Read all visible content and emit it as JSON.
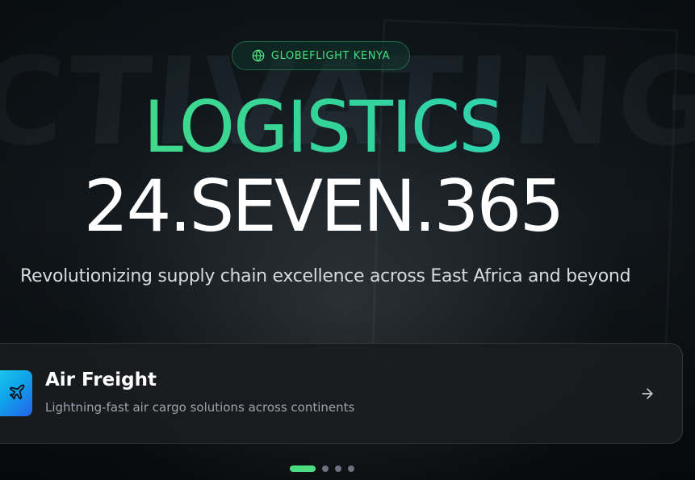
{
  "badge": {
    "icon": "globe-icon",
    "label": "GLOBEFLIGHT KENYA"
  },
  "hero": {
    "headline_line1": "LOGISTICS",
    "headline_line2": "24.SEVEN.365",
    "subtitle": "Revolutionizing supply chain excellence across East Africa and beyond"
  },
  "service": {
    "icon": "plane-icon",
    "title": "Air Freight",
    "description": "Lightning-fast air cargo solutions across continents",
    "next_icon": "arrow-right-icon"
  },
  "carousel": {
    "total": 4,
    "active_index": 0
  },
  "colors": {
    "accent_green": "#4ade80",
    "accent_teal": "#2dd4bf",
    "icon_gradient_start": "#22d3ee",
    "icon_gradient_end": "#2563eb"
  }
}
